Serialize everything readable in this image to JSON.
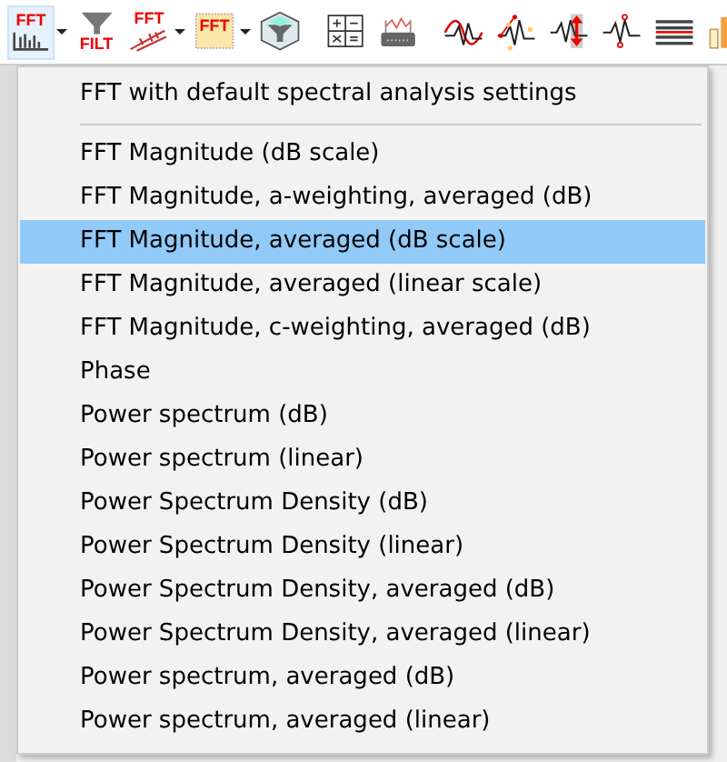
{
  "toolbar": [
    {
      "kind": "fft-bars",
      "label": "FFT",
      "dropdown": true,
      "selected": true
    },
    {
      "kind": "filter",
      "label": "FILT",
      "dropdown": false,
      "selected": false
    },
    {
      "kind": "fft-diagonal",
      "label": "FFT",
      "dropdown": true,
      "selected": false
    },
    {
      "kind": "fft-dotted",
      "label": "FFT",
      "dropdown": true,
      "selected": false
    },
    {
      "kind": "funnel-box",
      "dropdown": false,
      "selected": false
    },
    {
      "kind": "separator"
    },
    {
      "kind": "calculator",
      "dropdown": false,
      "selected": false
    },
    {
      "kind": "device",
      "dropdown": false,
      "selected": false
    },
    {
      "kind": "separator"
    },
    {
      "kind": "wave-red",
      "dropdown": false,
      "selected": false
    },
    {
      "kind": "wave-points",
      "dropdown": false,
      "selected": false
    },
    {
      "kind": "wave-arrow",
      "dropdown": false,
      "selected": false
    },
    {
      "kind": "wave-circles",
      "dropdown": false,
      "selected": false
    },
    {
      "kind": "lines",
      "dropdown": false,
      "selected": false
    },
    {
      "kind": "bars",
      "dropdown": false,
      "selected": false
    }
  ],
  "menu": {
    "items": [
      {
        "kind": "item",
        "label": "FFT with default spectral analysis settings",
        "selected": false
      },
      {
        "kind": "separator"
      },
      {
        "kind": "item",
        "label": "FFT Magnitude (dB scale)",
        "selected": false
      },
      {
        "kind": "item",
        "label": "FFT Magnitude, a-weighting, averaged (dB)",
        "selected": false
      },
      {
        "kind": "item",
        "label": "FFT Magnitude, averaged (dB scale)",
        "selected": true
      },
      {
        "kind": "item",
        "label": "FFT Magnitude, averaged (linear scale)",
        "selected": false
      },
      {
        "kind": "item",
        "label": "FFT Magnitude, c-weighting, averaged (dB)",
        "selected": false
      },
      {
        "kind": "item",
        "label": "Phase",
        "selected": false
      },
      {
        "kind": "item",
        "label": "Power spectrum (dB)",
        "selected": false
      },
      {
        "kind": "item",
        "label": "Power spectrum (linear)",
        "selected": false
      },
      {
        "kind": "item",
        "label": "Power Spectrum Density (dB)",
        "selected": false
      },
      {
        "kind": "item",
        "label": "Power Spectrum Density (linear)",
        "selected": false
      },
      {
        "kind": "item",
        "label": "Power Spectrum Density, averaged (dB)",
        "selected": false
      },
      {
        "kind": "item",
        "label": "Power Spectrum Density, averaged (linear)",
        "selected": false
      },
      {
        "kind": "item",
        "label": "Power spectrum, averaged (dB)",
        "selected": false
      },
      {
        "kind": "item",
        "label": "Power spectrum, averaged (linear)",
        "selected": false
      }
    ]
  }
}
